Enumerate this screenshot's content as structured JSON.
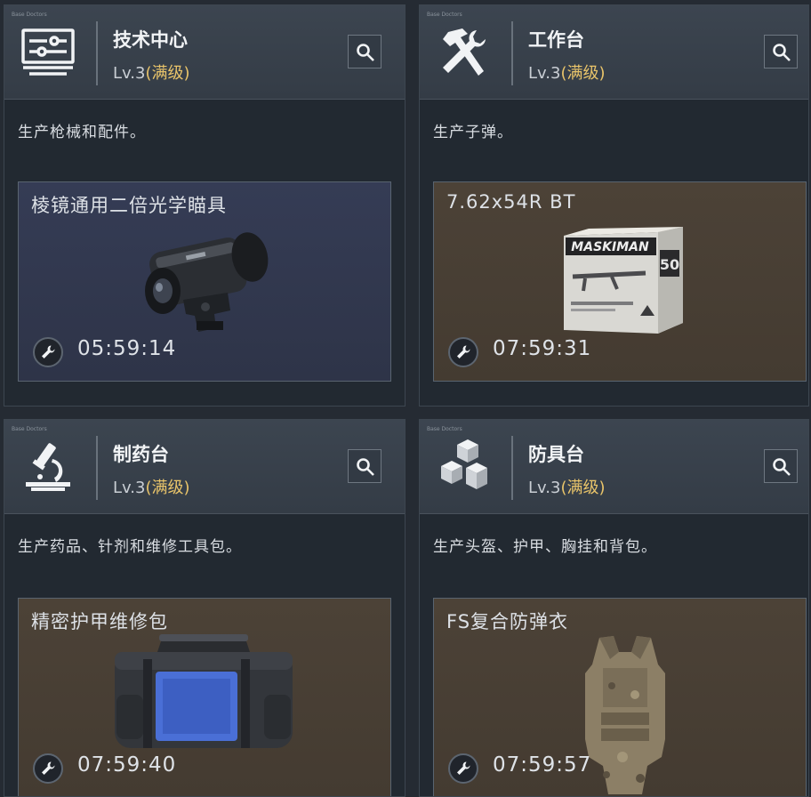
{
  "stations": [
    {
      "tiny": "Base Doctors",
      "icon": "computer-icon",
      "title": "技术中心",
      "level": "Lv.3",
      "level_max": "(满级)",
      "description": "生产枪械和配件。",
      "item": {
        "name": "棱镜通用二倍光学瞄具",
        "timer": "05:59:14",
        "image": "scope-image",
        "bg": "blue"
      }
    },
    {
      "tiny": "Base Doctors",
      "icon": "hammer-wrench-icon",
      "title": "工作台",
      "level": "Lv.3",
      "level_max": "(满级)",
      "description": "生产子弹。",
      "item": {
        "name": "7.62x54R BT",
        "timer": "07:59:31",
        "image": "ammo-box-image",
        "bg": "brown",
        "box_brand": "MASKIMAN",
        "box_count": "50"
      }
    },
    {
      "tiny": "Base Doctors",
      "icon": "microscope-icon",
      "title": "制药台",
      "level": "Lv.3",
      "level_max": "(满级)",
      "description": "生产药品、针剂和维修工具包。",
      "item": {
        "name": "精密护甲维修包",
        "timer": "07:59:40",
        "image": "repair-bag-image",
        "bg": "brown"
      }
    },
    {
      "tiny": "Base Doctors",
      "icon": "cubes-icon",
      "title": "防具台",
      "level": "Lv.3",
      "level_max": "(满级)",
      "description": "生产头盔、护甲、胸挂和背包。",
      "item": {
        "name": "FS复合防弹衣",
        "timer": "07:59:57",
        "image": "body-armor-image",
        "bg": "brown"
      }
    }
  ],
  "colors": {
    "accent_gold": "#e9c46a",
    "panel": "#222931",
    "header": "#3a434e"
  }
}
